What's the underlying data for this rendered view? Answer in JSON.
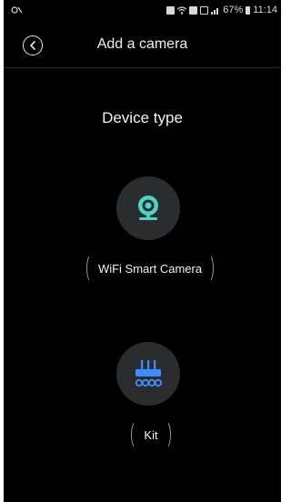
{
  "status_bar": {
    "battery_percent": "67%",
    "time": "11:14",
    "icons": [
      "notification-icon",
      "alarm-icon",
      "wifi-icon",
      "sim-icon",
      "image-icon",
      "signal-icon",
      "battery-icon"
    ]
  },
  "header": {
    "title": "Add a camera",
    "back_icon": "chevron-left-icon"
  },
  "main": {
    "section_title": "Device type",
    "devices": [
      {
        "label": "WiFi Smart Camera",
        "icon": "camera-icon",
        "icon_color": "#4fd3c9"
      },
      {
        "label": "Kit",
        "icon": "kit-icon",
        "icon_color": "#3f8cff"
      }
    ]
  },
  "colors": {
    "background": "#000000",
    "circle": "#2b2c2e",
    "camera_accent": "#4fd3c9",
    "kit_accent": "#3f8cff",
    "text": "#f0f0f0"
  }
}
